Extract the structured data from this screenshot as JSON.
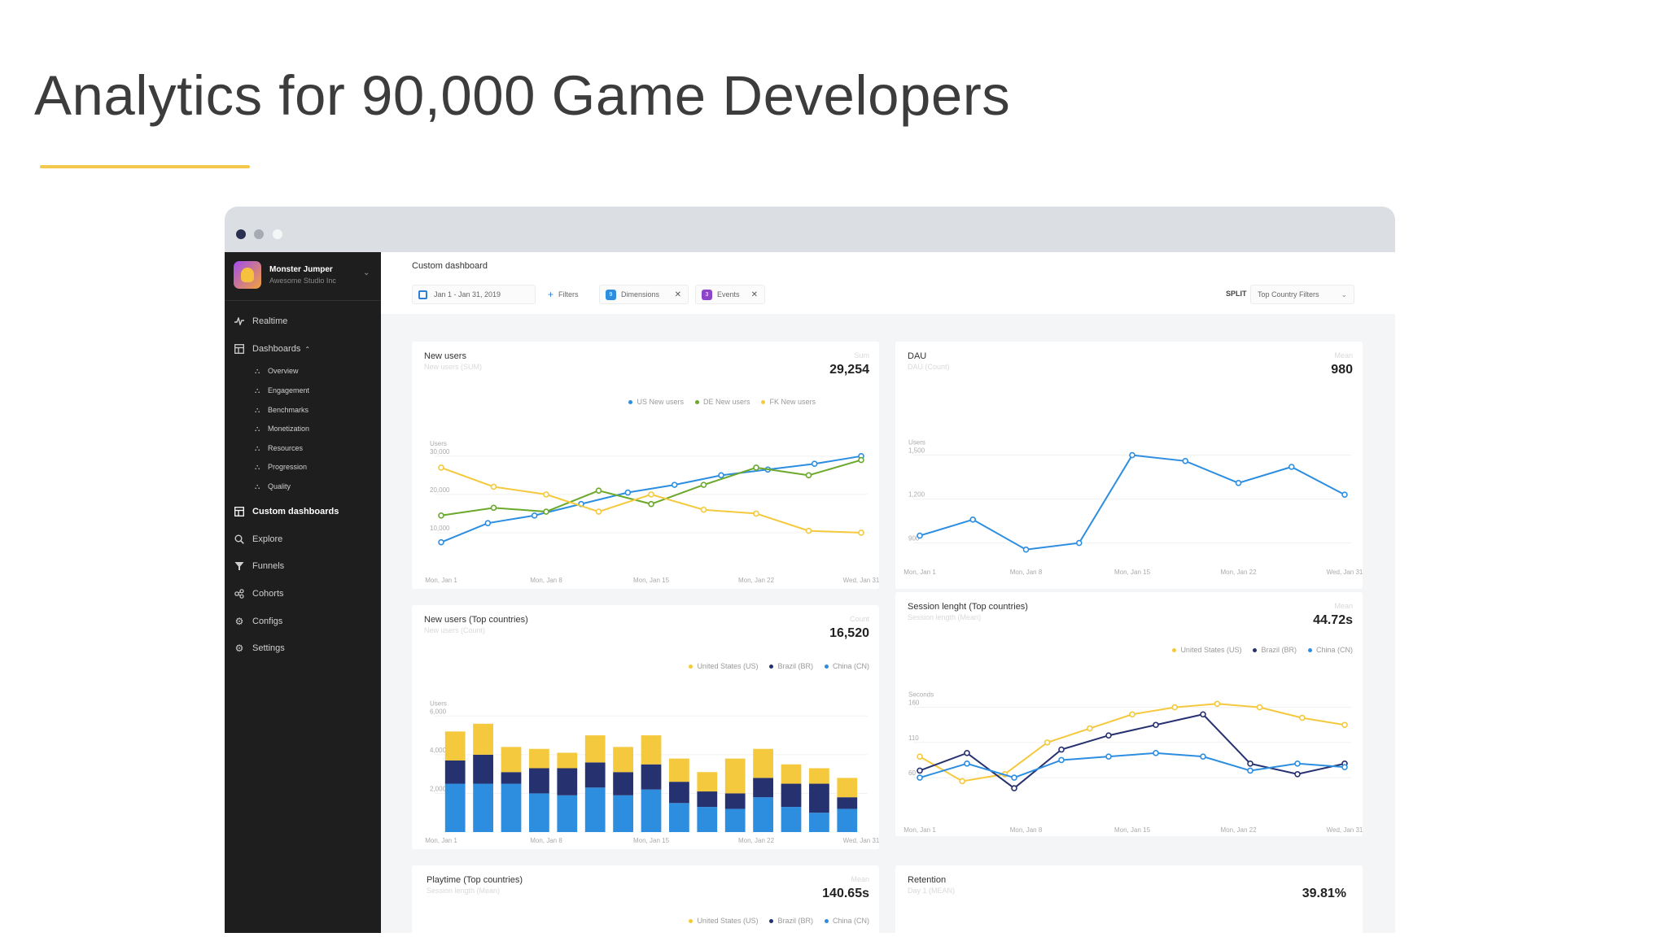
{
  "slide": {
    "title": "Analytics for 90,000 Game Developers"
  },
  "app": {
    "name": "Monster Jumper",
    "studio": "Awesome Studio Inc"
  },
  "sidebar": {
    "items": [
      {
        "label": "Realtime",
        "icon": "pulse-icon"
      },
      {
        "label": "Dashboards",
        "icon": "grid-icon"
      },
      {
        "label": "Custom dashboards",
        "icon": "grid-icon"
      },
      {
        "label": "Explore",
        "icon": "search-icon"
      },
      {
        "label": "Funnels",
        "icon": "funnel-icon"
      },
      {
        "label": "Cohorts",
        "icon": "cohorts-icon"
      },
      {
        "label": "Configs",
        "icon": "gear-icon"
      },
      {
        "label": "Settings",
        "icon": "gear-icon"
      }
    ],
    "dashboard_subitems": [
      "Overview",
      "Engagement",
      "Benchmarks",
      "Monetization",
      "Resources",
      "Progression",
      "Quality"
    ]
  },
  "topbar": {
    "title": "Custom dashboard",
    "date_range": "Jan 1 - Jan 31, 2019",
    "filters_label": "Filters",
    "dimensions_label": "Dimensions",
    "dimensions_count": "9",
    "events_label": "Events",
    "events_count": "3",
    "split_label": "SPLIT",
    "split_value": "Top Country Filters"
  },
  "colors": {
    "blue": "#2d8ee0",
    "green": "#6ba82c",
    "yellow": "#f4c93d",
    "navy": "#263170",
    "sidebar": "#1e1e1e"
  },
  "cards": {
    "new_users": {
      "title": "New users",
      "subtitle": "New users (SUM)",
      "agg": "Sum",
      "value": "29,254",
      "y_unit": "Users"
    },
    "dau": {
      "title": "DAU",
      "subtitle": "DAU (Count)",
      "agg": "Mean",
      "value": "980",
      "y_unit": "Users"
    },
    "new_users_top": {
      "title": "New users (Top countries)",
      "subtitle": "New users (Count)",
      "agg": "Count",
      "value": "16,520",
      "y_unit": "Users"
    },
    "session_length": {
      "title": "Session lenght (Top countries)",
      "subtitle": "Session length (Mean)",
      "agg": "Mean",
      "value": "44.72s",
      "y_unit": "Seconds"
    },
    "playtime": {
      "title": "Playtime (Top countries)",
      "subtitle": "Session length (Mean)",
      "agg": "Mean",
      "value": "140.65s"
    },
    "retention": {
      "title": "Retention",
      "subtitle": "Day 1 (MEAN)",
      "agg": "",
      "value": "39.81%"
    }
  },
  "chart_data": [
    {
      "type": "line",
      "title": "New users",
      "x_labels": [
        "Mon, Jan 1",
        "Mon, Jan 8",
        "Mon, Jan 15",
        "Mon, Jan 22",
        "Wed, Jan 31"
      ],
      "y_ticks": [
        "10,000",
        "20,000",
        "30,000"
      ],
      "ylim": [
        0,
        34000
      ],
      "series": [
        {
          "name": "US New users",
          "color": "#2d8ee0",
          "values": [
            7500,
            12500,
            14500,
            17500,
            20500,
            22500,
            25000,
            26500,
            28000,
            30000
          ]
        },
        {
          "name": "DE New users",
          "color": "#6ba82c",
          "values": [
            14500,
            16500,
            15500,
            21000,
            17500,
            22500,
            27000,
            25000,
            29000
          ]
        },
        {
          "name": "FK New users",
          "color": "#f4c93d",
          "values": [
            27000,
            22000,
            20000,
            15500,
            20000,
            16000,
            15000,
            10500,
            10000
          ]
        }
      ]
    },
    {
      "type": "line",
      "title": "DAU",
      "x_labels": [
        "Mon, Jan 1",
        "Mon, Jan 8",
        "Mon, Jan 15",
        "Mon, Jan 22",
        "Wed, Jan 31"
      ],
      "y_ticks": [
        "900",
        "1,200",
        "1,500"
      ],
      "ylim": [
        720,
        1620
      ],
      "series": [
        {
          "name": "DAU",
          "color": "#2d8ee0",
          "values": [
            950,
            1060,
            855,
            900,
            1500,
            1460,
            1310,
            1420,
            1230
          ]
        }
      ]
    },
    {
      "type": "bar",
      "title": "New users (Top countries)",
      "x_labels": [
        "Mon, Jan 1",
        "Mon, Jan 8",
        "Mon, Jan 15",
        "Mon, Jan 22",
        "Wed, Jan 31"
      ],
      "y_ticks": [
        "2,000",
        "4,000",
        "6,000"
      ],
      "ylim": [
        0,
        6600
      ],
      "stacked": true,
      "series": [
        {
          "name": "China (CN)",
          "color": "#2d8ee0",
          "values": [
            2500,
            2500,
            2500,
            2000,
            1900,
            2300,
            1900,
            2200,
            1500,
            1300,
            1200,
            1800,
            1300,
            1000,
            1200
          ]
        },
        {
          "name": "Brazil (BR)",
          "color": "#263170",
          "values": [
            1200,
            1500,
            600,
            1300,
            1400,
            1300,
            1200,
            1300,
            1100,
            800,
            800,
            1000,
            1200,
            1500,
            600
          ]
        },
        {
          "name": "United States (US)",
          "color": "#f4c93d",
          "values": [
            1500,
            1600,
            1300,
            1000,
            800,
            1400,
            1300,
            1500,
            1200,
            1000,
            1800,
            1500,
            1000,
            800,
            1000
          ]
        }
      ]
    },
    {
      "type": "line",
      "title": "Session lenght (Top countries)",
      "x_labels": [
        "Mon, Jan 1",
        "Mon, Jan 8",
        "Mon, Jan 15",
        "Mon, Jan 22",
        "Wed, Jan 31"
      ],
      "y_ticks": [
        "60",
        "110",
        "160"
      ],
      "ylim": [
        0,
        185
      ],
      "series": [
        {
          "name": "United States (US)",
          "color": "#f4c93d",
          "values": [
            90,
            55,
            65,
            110,
            130,
            150,
            160,
            165,
            160,
            145,
            135
          ]
        },
        {
          "name": "Brazil (BR)",
          "color": "#263170",
          "values": [
            70,
            95,
            45,
            100,
            120,
            135,
            150,
            80,
            65,
            80
          ]
        },
        {
          "name": "China (CN)",
          "color": "#2d8ee0",
          "values": [
            60,
            80,
            60,
            85,
            90,
            95,
            90,
            70,
            80,
            75
          ]
        }
      ]
    }
  ]
}
